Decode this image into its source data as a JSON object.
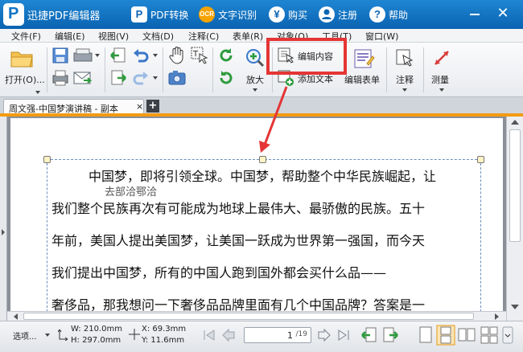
{
  "titlebar": {
    "app_title": "迅捷PDF编辑器",
    "pdf_convert": "PDF转换",
    "ocr_badge": "OCR",
    "ocr": "文字识别",
    "buy": "购买",
    "register": "注册",
    "help": "帮助",
    "buy_icon_glyph": "¥",
    "help_icon_glyph": "?",
    "close_glyph": "✕"
  },
  "menu": [
    "文件(F)",
    "编辑(E)",
    "视图(V)",
    "文档(D)",
    "注释(C)",
    "表单(R)",
    "对象(O)",
    "工具(T)",
    "窗口(W)"
  ],
  "toolbar": {
    "open": "打开(O)...",
    "zoom_in": "放大",
    "edit_content": "编辑内容",
    "add_text": "添加文本",
    "edit_form": "编辑表单",
    "annotate": "注释",
    "measure": "测量"
  },
  "tab": {
    "title": "周文强-中国梦演讲稿 - 副本",
    "close": "×",
    "new_tab": "+"
  },
  "document": {
    "annotation": "去部洽鄂洽",
    "lines": [
      "中国梦，即将引领全球。中国梦，帮助整个中华民族崛起，让",
      "我们整个民族再次有可能成为地球上最伟大、最骄傲的民族。五十",
      "年前，美国人提出美国梦，让美国一跃成为世界第一强国，而今天",
      "我们提出中国梦，所有的中国人跑到国外都会买什么品——",
      "奢侈品，那我想问一下奢侈品品牌里面有几个中国品牌？答案是一"
    ]
  },
  "status": {
    "select_tool": "选项...",
    "width": "W: 210.0mm",
    "height": "H: 297.0mm",
    "x": "X:   69.3mm",
    "y": "Y:   11.6mm",
    "page_current": "1",
    "page_total": "/19"
  },
  "colors": {
    "titlebar": "#1477c8",
    "highlight": "#e53535",
    "tab_accent": "#f29b12"
  }
}
